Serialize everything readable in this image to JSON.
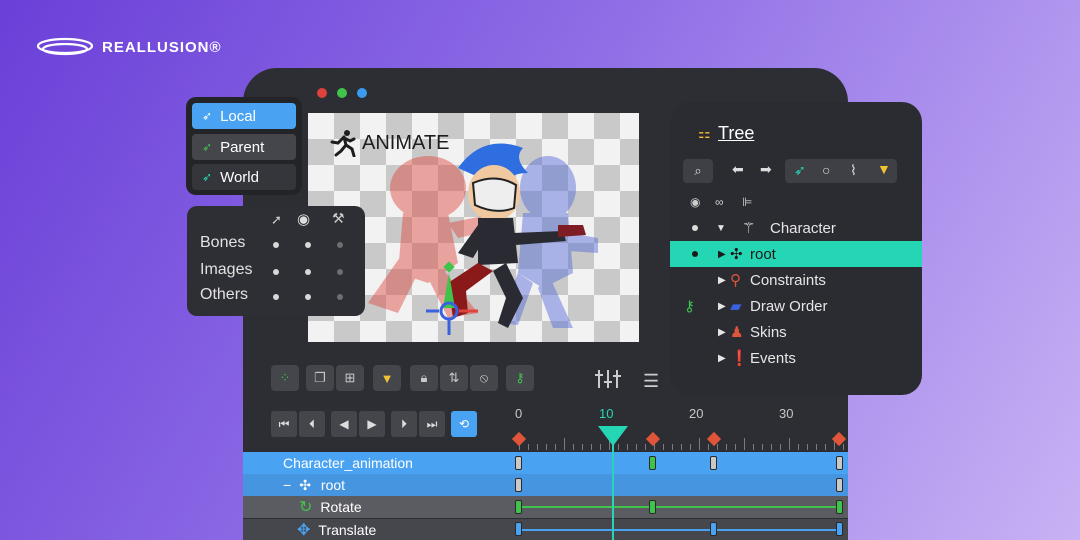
{
  "brand": {
    "logo_text": "REALLUSION®"
  },
  "window": {
    "dot_colors": [
      "#e0413a",
      "#3fc34b",
      "#3a9bf0"
    ]
  },
  "viewport": {
    "mode_label": "ANIMATE"
  },
  "transform_space": {
    "items": [
      {
        "label": "Local",
        "selected": true
      },
      {
        "label": "Parent",
        "selected": false
      },
      {
        "label": "World",
        "selected": false
      }
    ]
  },
  "visibility": {
    "columns": [
      "select-arrow-icon",
      "eye-icon",
      "bone-icon"
    ],
    "rows": [
      {
        "label": "Bones",
        "states": [
          true,
          true,
          false
        ]
      },
      {
        "label": "Images",
        "states": [
          true,
          true,
          false
        ]
      },
      {
        "label": "Others",
        "states": [
          true,
          true,
          false
        ]
      }
    ]
  },
  "tree": {
    "title": "Tree",
    "items": [
      {
        "label": "Character",
        "icon": "figure-icon",
        "selected": false
      },
      {
        "label": "root",
        "icon": "bone-cross-icon",
        "selected": true
      },
      {
        "label": "Constraints",
        "icon": "constraint-icon",
        "selected": false
      },
      {
        "label": "Draw Order",
        "icon": "draw-order-icon",
        "selected": false
      },
      {
        "label": "Skins",
        "icon": "skins-icon",
        "selected": false
      },
      {
        "label": "Events",
        "icon": "events-icon",
        "selected": false
      }
    ]
  },
  "timeline": {
    "ruler": [
      "0",
      "10",
      "20",
      "30"
    ],
    "current_frame": 10,
    "tracks": [
      {
        "label": "Character_animation",
        "type": "animation"
      },
      {
        "label": "root",
        "type": "bone"
      },
      {
        "label": "Rotate",
        "type": "rotate"
      },
      {
        "label": "Translate",
        "type": "translate"
      }
    ]
  },
  "colors": {
    "accent_teal": "#25d6b4",
    "selection_blue": "#4aa3f2",
    "key_red": "#e0553a"
  }
}
